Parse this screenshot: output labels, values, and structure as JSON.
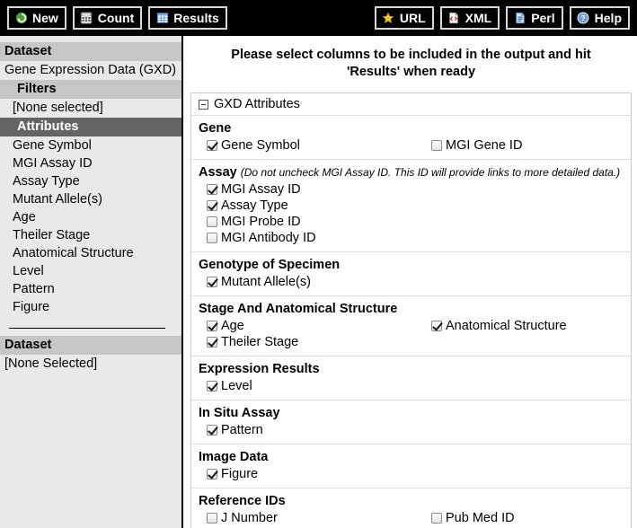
{
  "toolbar": {
    "left_buttons": [
      {
        "label": "New",
        "icon": "refresh-circle-icon"
      },
      {
        "label": "Count",
        "icon": "calculator-icon"
      },
      {
        "label": "Results",
        "icon": "table-grid-icon"
      }
    ],
    "right_buttons": [
      {
        "label": "URL",
        "icon": "star-icon"
      },
      {
        "label": "XML",
        "icon": "xml-document-icon"
      },
      {
        "label": "Perl",
        "icon": "perl-document-icon"
      },
      {
        "label": "Help",
        "icon": "question-circle-icon"
      }
    ]
  },
  "sidebar": {
    "dataset_label": "Dataset",
    "dataset_value": "Gene Expression Data (GXD)",
    "filters_label": "Filters",
    "filters_value": "[None selected]",
    "attributes_label": "Attributes",
    "attribute_items": [
      "Gene Symbol",
      "MGI Assay ID",
      "Assay Type",
      "Mutant Allele(s)",
      "Age",
      "Theiler Stage",
      "Anatomical Structure",
      "Level",
      "Pattern",
      "Figure"
    ],
    "dataset2_label": "Dataset",
    "dataset2_value": "[None Selected]"
  },
  "main": {
    "title": "Please select columns to be included in the output and hit 'Results' when ready",
    "panel_title": "GXD Attributes",
    "sections": [
      {
        "title": "Gene",
        "note": "",
        "left": [
          {
            "label": "Gene Symbol",
            "checked": true
          }
        ],
        "right": [
          {
            "label": "MGI Gene ID",
            "checked": false
          }
        ]
      },
      {
        "title": "Assay",
        "note": "(Do not uncheck MGI Assay ID. This ID will provide links to more detailed data.)",
        "left": [
          {
            "label": "MGI Assay ID",
            "checked": true
          },
          {
            "label": "Assay Type",
            "checked": true
          },
          {
            "label": "MGI Probe ID",
            "checked": false
          },
          {
            "label": "MGI Antibody ID",
            "checked": false
          }
        ],
        "right": []
      },
      {
        "title": "Genotype of Specimen",
        "note": "",
        "left": [
          {
            "label": "Mutant Allele(s)",
            "checked": true
          }
        ],
        "right": []
      },
      {
        "title": "Stage And Anatomical Structure",
        "note": "",
        "left": [
          {
            "label": "Age",
            "checked": true
          },
          {
            "label": "Theiler Stage",
            "checked": true
          }
        ],
        "right": [
          {
            "label": "Anatomical Structure",
            "checked": true
          }
        ]
      },
      {
        "title": "Expression Results",
        "note": "",
        "left": [
          {
            "label": "Level",
            "checked": true
          }
        ],
        "right": []
      },
      {
        "title": "In Situ Assay",
        "note": "",
        "left": [
          {
            "label": "Pattern",
            "checked": true
          }
        ],
        "right": []
      },
      {
        "title": "Image Data",
        "note": "",
        "left": [
          {
            "label": "Figure",
            "checked": true
          }
        ],
        "right": []
      },
      {
        "title": "Reference IDs",
        "note": "",
        "left": [
          {
            "label": "J Number",
            "checked": false
          }
        ],
        "right": [
          {
            "label": "Pub Med ID",
            "checked": false
          }
        ]
      }
    ]
  },
  "colors": {
    "toolbar_bg": "#000000",
    "sidebar_bg": "#e9e9e9",
    "sidebar_head_bg": "#c6c6c6",
    "sidebar_selected_bg": "#646464",
    "new_icon_green": "#4e9a3a",
    "url_icon_gold": "#f2c12e",
    "xml_icon_red": "#cc2222",
    "perl_icon_blue": "#4a7fc1"
  }
}
